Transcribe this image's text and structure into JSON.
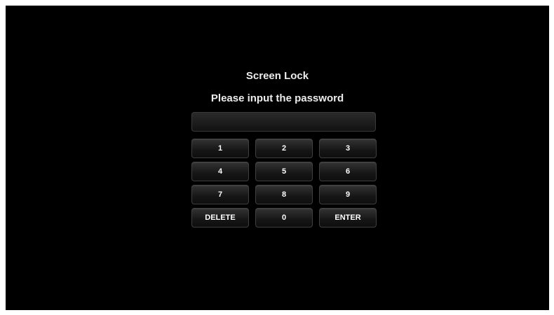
{
  "lock": {
    "title": "Screen Lock",
    "prompt": "Please input the password",
    "password_value": ""
  },
  "keypad": {
    "keys": [
      "1",
      "2",
      "3",
      "4",
      "5",
      "6",
      "7",
      "8",
      "9",
      "DELETE",
      "0",
      "ENTER"
    ]
  },
  "colors": {
    "background": "#000000",
    "text": "#ececec",
    "key_border": "#3f3f3f"
  }
}
